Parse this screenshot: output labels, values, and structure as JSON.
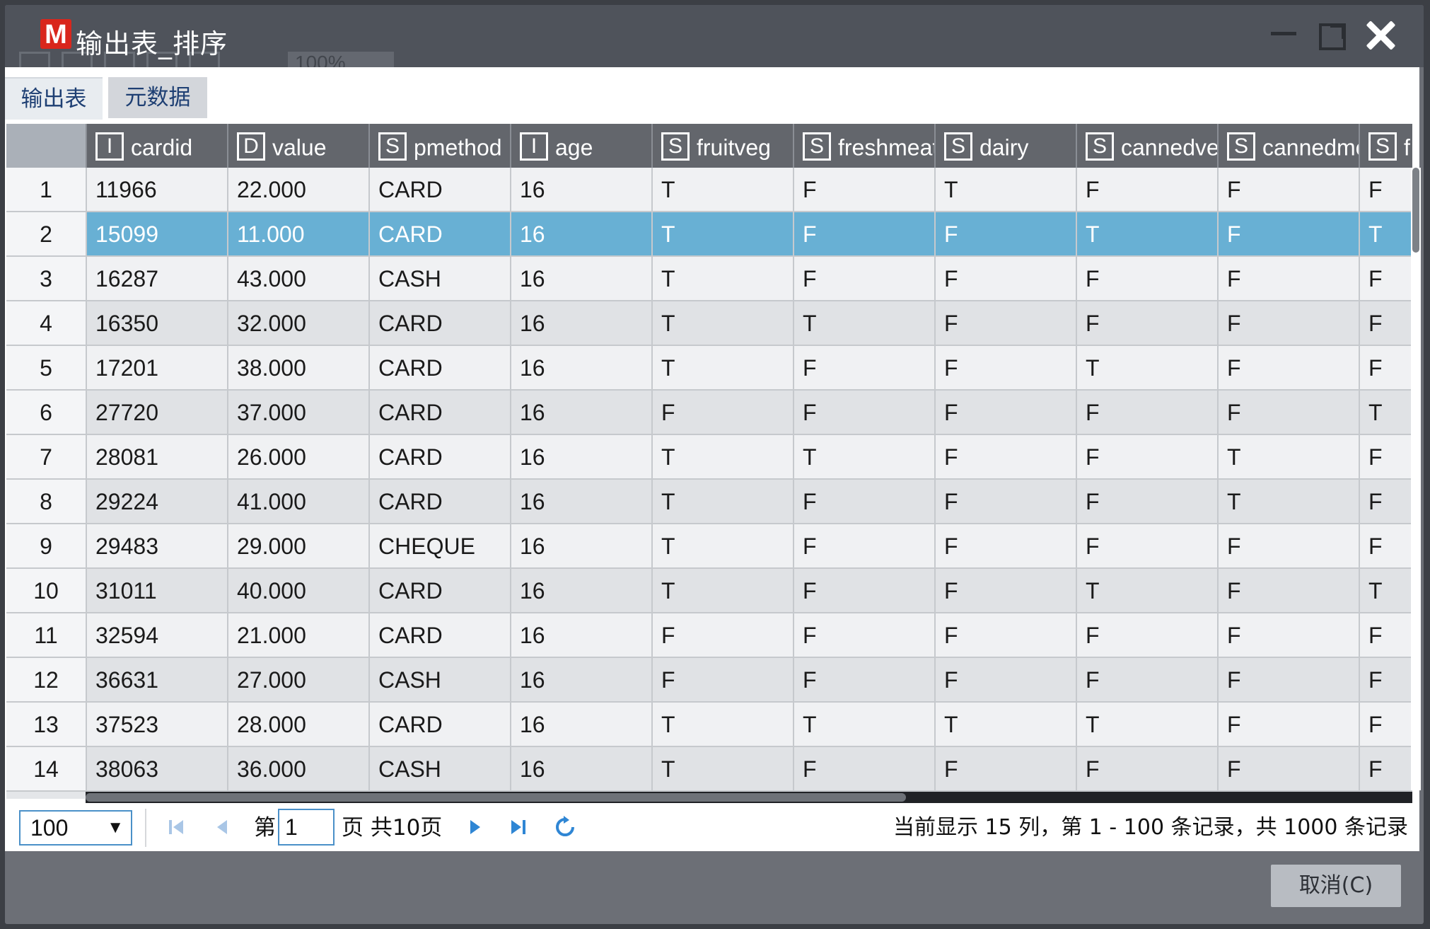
{
  "window": {
    "title": "输出表_排序",
    "logo_letter": "M",
    "ghost_zoom": "100%"
  },
  "tabs": [
    {
      "label": "输出表",
      "active": true
    },
    {
      "label": "元数据",
      "active": false
    }
  ],
  "grid": {
    "columns": [
      {
        "type": "I",
        "name": "cardid"
      },
      {
        "type": "D",
        "name": "value"
      },
      {
        "type": "S",
        "name": "pmethod"
      },
      {
        "type": "I",
        "name": "age"
      },
      {
        "type": "S",
        "name": "fruitveg"
      },
      {
        "type": "S",
        "name": "freshmeat"
      },
      {
        "type": "S",
        "name": "dairy"
      },
      {
        "type": "S",
        "name": "cannedveg"
      },
      {
        "type": "S",
        "name": "cannedmeat"
      },
      {
        "type": "S",
        "name": "f"
      }
    ],
    "selected_row": 2,
    "rows": [
      {
        "num": "1",
        "cells": [
          "11966",
          "22.000",
          "CARD",
          "16",
          "T",
          "F",
          "T",
          "F",
          "F",
          "F"
        ]
      },
      {
        "num": "2",
        "cells": [
          "15099",
          "11.000",
          "CARD",
          "16",
          "T",
          "F",
          "F",
          "T",
          "F",
          "T"
        ]
      },
      {
        "num": "3",
        "cells": [
          "16287",
          "43.000",
          "CASH",
          "16",
          "T",
          "F",
          "F",
          "F",
          "F",
          "F"
        ]
      },
      {
        "num": "4",
        "cells": [
          "16350",
          "32.000",
          "CARD",
          "16",
          "T",
          "T",
          "F",
          "F",
          "F",
          "F"
        ]
      },
      {
        "num": "5",
        "cells": [
          "17201",
          "38.000",
          "CARD",
          "16",
          "T",
          "F",
          "F",
          "T",
          "F",
          "F"
        ]
      },
      {
        "num": "6",
        "cells": [
          "27720",
          "37.000",
          "CARD",
          "16",
          "F",
          "F",
          "F",
          "F",
          "F",
          "T"
        ]
      },
      {
        "num": "7",
        "cells": [
          "28081",
          "26.000",
          "CARD",
          "16",
          "T",
          "T",
          "F",
          "F",
          "T",
          "F"
        ]
      },
      {
        "num": "8",
        "cells": [
          "29224",
          "41.000",
          "CARD",
          "16",
          "T",
          "F",
          "F",
          "F",
          "T",
          "F"
        ]
      },
      {
        "num": "9",
        "cells": [
          "29483",
          "29.000",
          "CHEQUE",
          "16",
          "T",
          "F",
          "F",
          "F",
          "F",
          "F"
        ]
      },
      {
        "num": "10",
        "cells": [
          "31011",
          "40.000",
          "CARD",
          "16",
          "T",
          "F",
          "F",
          "T",
          "F",
          "T"
        ]
      },
      {
        "num": "11",
        "cells": [
          "32594",
          "21.000",
          "CARD",
          "16",
          "F",
          "F",
          "F",
          "F",
          "F",
          "F"
        ]
      },
      {
        "num": "12",
        "cells": [
          "36631",
          "27.000",
          "CASH",
          "16",
          "F",
          "F",
          "F",
          "F",
          "F",
          "F"
        ]
      },
      {
        "num": "13",
        "cells": [
          "37523",
          "28.000",
          "CARD",
          "16",
          "T",
          "T",
          "T",
          "T",
          "F",
          "F"
        ]
      },
      {
        "num": "14",
        "cells": [
          "38063",
          "36.000",
          "CASH",
          "16",
          "T",
          "F",
          "F",
          "F",
          "F",
          "F"
        ]
      }
    ]
  },
  "pager": {
    "page_size": "100",
    "page_prefix": "第",
    "current_page": "1",
    "page_suffix": "页 共10页",
    "status": "当前显示 15 列，第 1 - 100 条记录，共 1000 条记录"
  },
  "footer": {
    "cancel_label": "取消(C)"
  },
  "colors": {
    "selected_row": "#68b0d4",
    "header_bg": "#63666c",
    "accent_blue": "#4a90c8"
  },
  "icons": [
    "close-icon",
    "maximize-icon",
    "minimize-icon",
    "first-page-icon",
    "prev-page-icon",
    "next-page-icon",
    "last-page-icon",
    "refresh-icon",
    "dropdown-caret-icon"
  ]
}
